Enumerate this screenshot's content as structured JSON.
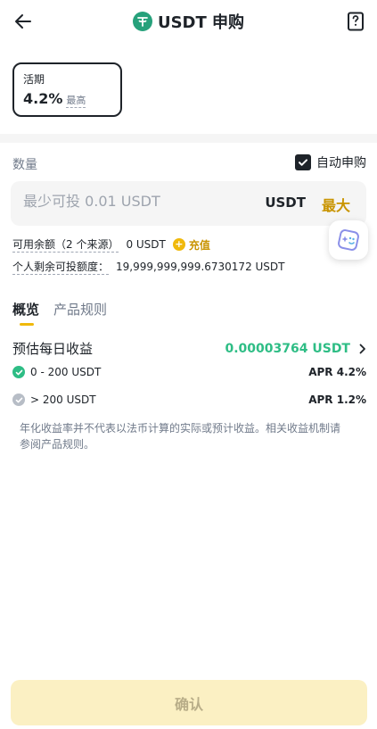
{
  "header": {
    "title": "USDT 申购"
  },
  "term": {
    "name": "活期",
    "rate": "4.2%",
    "tag": "最高"
  },
  "amount": {
    "label": "数量",
    "auto_subscribe_label": "自动申购",
    "auto_subscribe_checked": true,
    "placeholder": "最少可投 0.01 USDT",
    "currency": "USDT",
    "max_label": "最大"
  },
  "balance": {
    "label": "可用余额（2 个来源）",
    "value": "0 USDT",
    "deposit_label": "充值"
  },
  "quota": {
    "label": "个人剩余可投额度：",
    "value": "19,999,999,999.6730172 USDT"
  },
  "tabs": [
    {
      "label": "概览"
    },
    {
      "label": "产品规则"
    }
  ],
  "estimate": {
    "label": "预估每日收益",
    "value": "0.00003764 USDT"
  },
  "tiers": [
    {
      "range": "0 - 200 USDT",
      "apr": "APR 4.2%"
    },
    {
      "range": "> 200 USDT",
      "apr": "APR 1.2%"
    }
  ],
  "disclaimer": "年化收益率并不代表以法币计算的实际或预计收益。相关收益机制请参阅产品规则。",
  "confirm_label": "确认",
  "colors": {
    "accent": "#f0b90b",
    "accent_text": "#c99400",
    "positive": "#2ebd85",
    "confirm_disabled_bg": "#fbf0c3"
  }
}
